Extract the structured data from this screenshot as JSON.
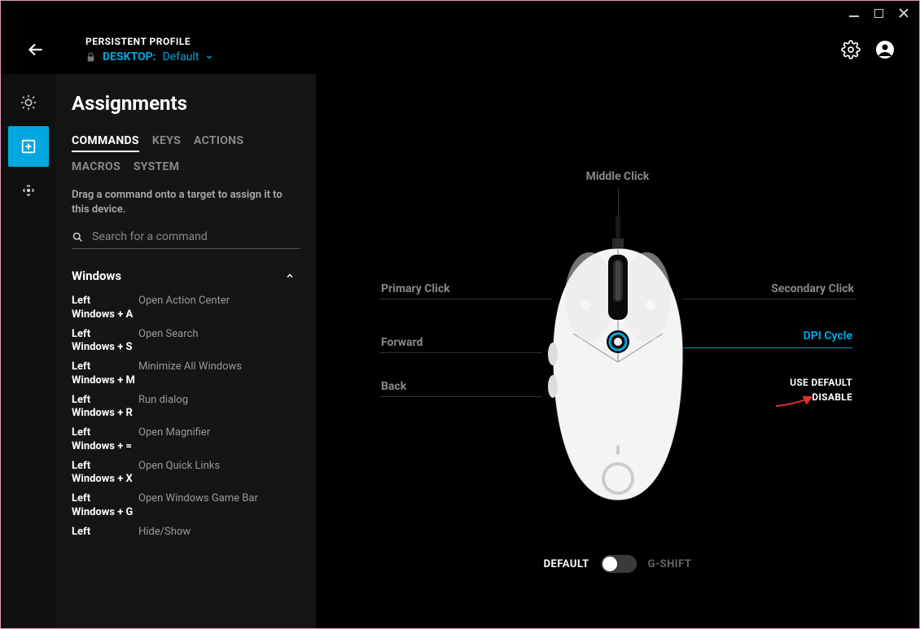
{
  "header": {
    "persistent": "PERSISTENT PROFILE",
    "prefix": "DESKTOP:",
    "profile": "Default"
  },
  "sidepanel": {
    "title": "Assignments",
    "tabs": [
      "COMMANDS",
      "KEYS",
      "ACTIONS",
      "MACROS",
      "SYSTEM"
    ],
    "active_tab": 0,
    "hint": "Drag a command onto a target to assign it to this device.",
    "search_placeholder": "Search for a command",
    "group": "Windows",
    "commands": [
      {
        "key": "Left Windows + A",
        "act": "Open Action Center"
      },
      {
        "key": "Left Windows + S",
        "act": "Open Search"
      },
      {
        "key": "Left Windows + M",
        "act": "Minimize All Windows"
      },
      {
        "key": "Left Windows + R",
        "act": "Run dialog"
      },
      {
        "key": "Left Windows + =",
        "act": "Open Magnifier"
      },
      {
        "key": "Left Windows + X",
        "act": "Open Quick Links"
      },
      {
        "key": "Left Windows + G",
        "act": "Open Windows Game Bar"
      },
      {
        "key": "Left",
        "act": "Hide/Show"
      }
    ]
  },
  "canvas": {
    "labels": {
      "middle": "Middle Click",
      "primary": "Primary Click",
      "secondary": "Secondary Click",
      "forward": "Forward",
      "back": "Back",
      "dpi": "DPI Cycle"
    },
    "context": {
      "use_default": "USE DEFAULT",
      "disable": "DISABLE"
    },
    "toggle": {
      "a": "DEFAULT",
      "b": "G-SHIFT"
    }
  },
  "colors": {
    "accent": "#00a7e0"
  }
}
